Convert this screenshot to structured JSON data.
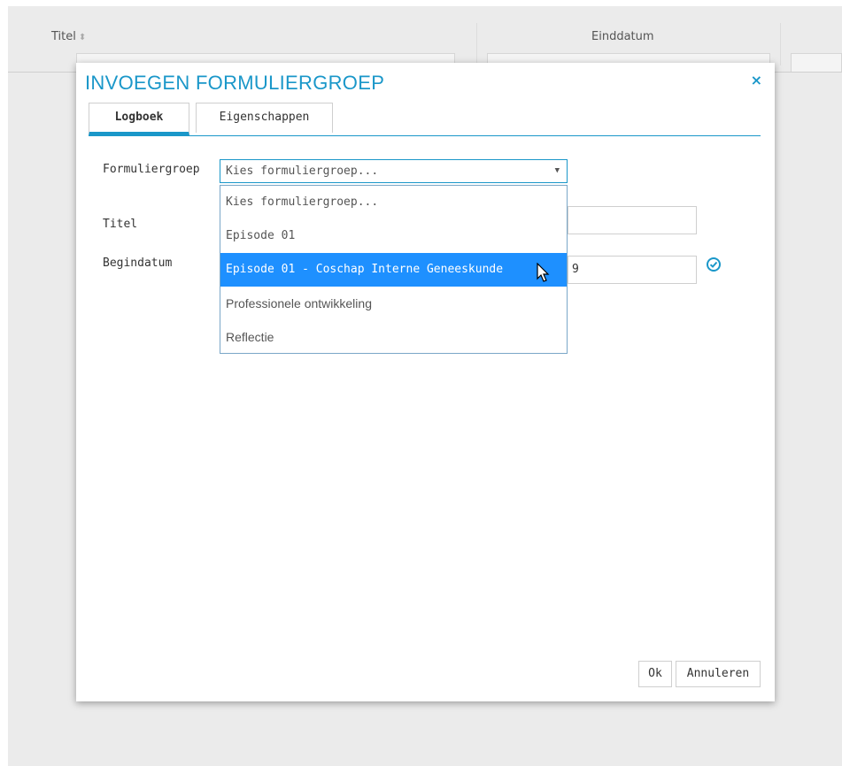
{
  "background": {
    "col_titel": "Titel",
    "col_einddatum": "Einddatum"
  },
  "modal": {
    "title": "INVOEGEN FORMULIERGROEP",
    "close": "×",
    "tabs": [
      {
        "label": "Logboek",
        "active": true
      },
      {
        "label": "Eigenschappen",
        "active": false
      }
    ],
    "fields": {
      "formuliergroep_label": "Formuliergroep",
      "formuliergroep_value": "Kies formuliergroep...",
      "titel_label": "Titel",
      "titel_value": "",
      "begindatum_label": "Begindatum",
      "begindatum_value": "9"
    },
    "dropdown_options": [
      "Kies formuliergroep...",
      "Episode 01",
      "Episode 01 - Coschap Interne Geneeskunde",
      "Professionele ontwikkeling",
      "Reflectie"
    ],
    "selected_option_index": 2,
    "buttons": {
      "ok": "Ok",
      "cancel": "Annuleren"
    }
  },
  "colors": {
    "accent": "#1a97c9",
    "selected_option": "#1e90ff"
  }
}
